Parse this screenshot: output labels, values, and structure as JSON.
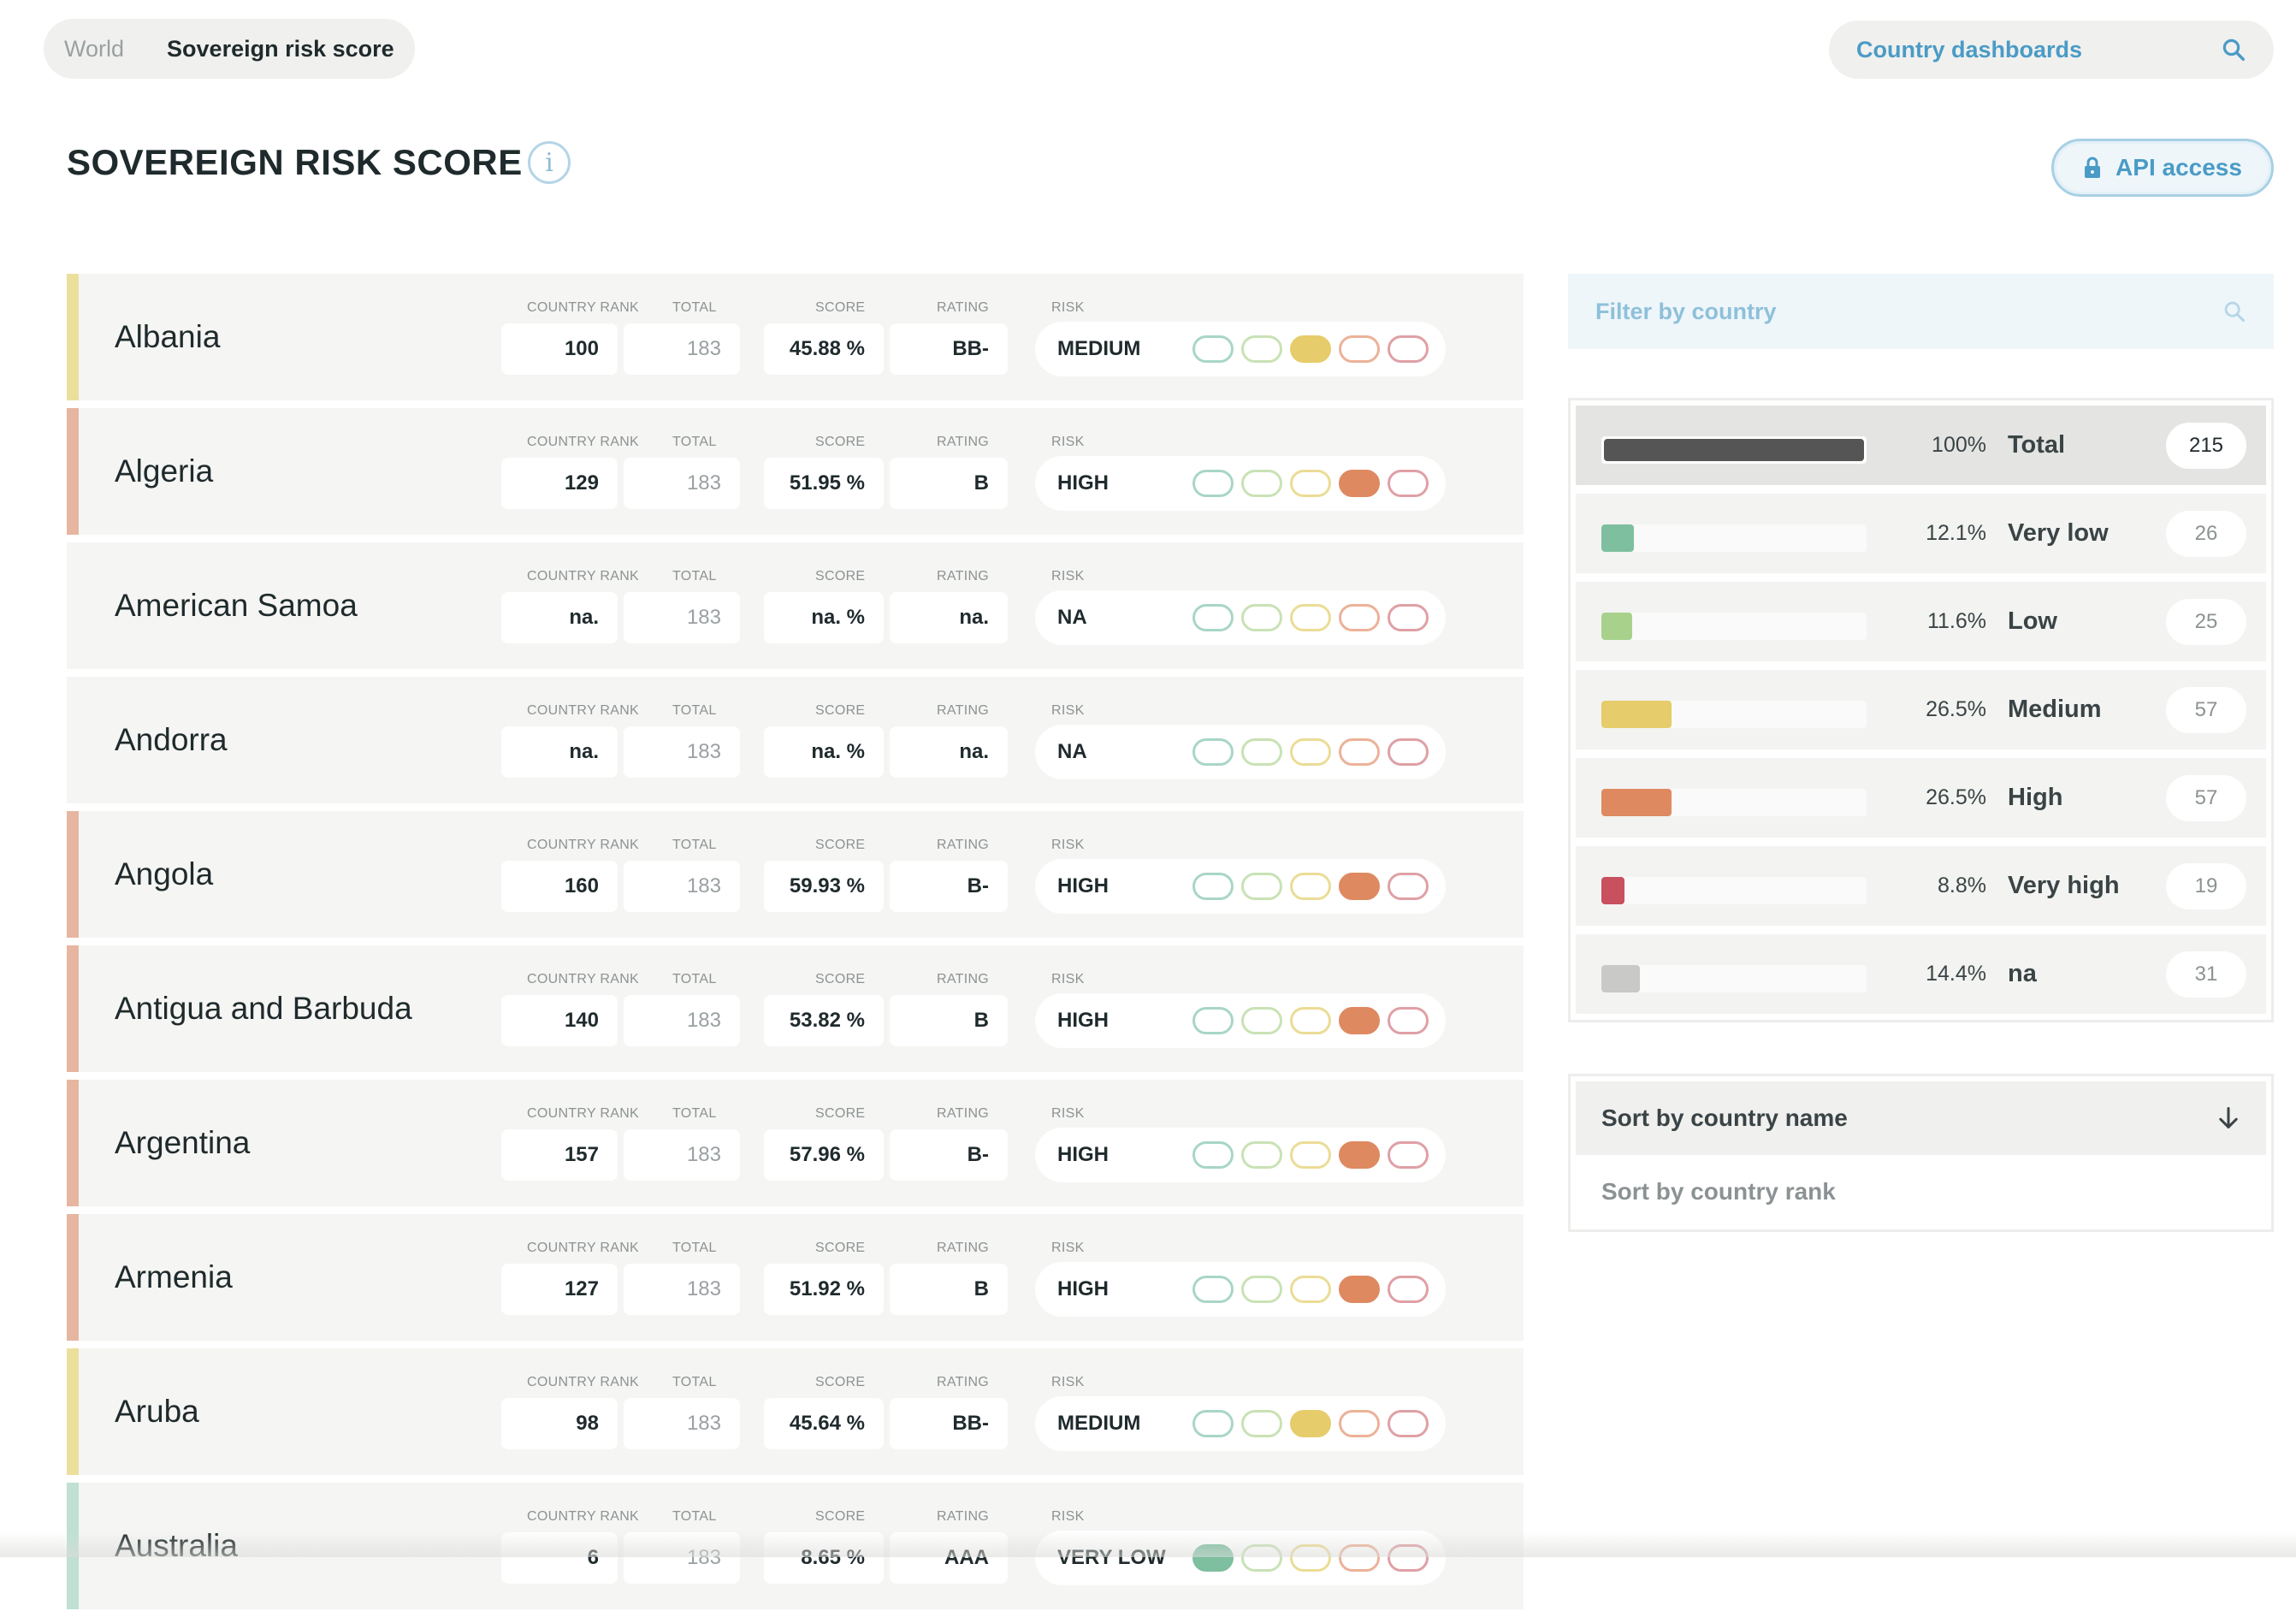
{
  "breadcrumb": {
    "world": "World",
    "current": "Sovereign risk score"
  },
  "dashboard_search": {
    "label": "Country dashboards"
  },
  "page": {
    "title": "SOVEREIGN RISK SCORE",
    "info_glyph": "i",
    "api_button": "API access"
  },
  "columns": {
    "rank": "COUNTRY RANK",
    "total": "TOTAL",
    "score": "SCORE",
    "rating": "RATING",
    "risk": "RISK"
  },
  "countries": [
    {
      "name": "Albania",
      "rank": "100",
      "total": "183",
      "score": "45.88 %",
      "rating": "BB-",
      "risk": "MEDIUM",
      "level": 3,
      "accent": "#ebdf9c"
    },
    {
      "name": "Algeria",
      "rank": "129",
      "total": "183",
      "score": "51.95 %",
      "rating": "B",
      "risk": "HIGH",
      "level": 4,
      "accent": "#e6b6a0"
    },
    {
      "name": "American Samoa",
      "rank": "na.",
      "total": "183",
      "score": "na. %",
      "rating": "na.",
      "risk": "NA",
      "level": 0,
      "accent": ""
    },
    {
      "name": "Andorra",
      "rank": "na.",
      "total": "183",
      "score": "na. %",
      "rating": "na.",
      "risk": "NA",
      "level": 0,
      "accent": ""
    },
    {
      "name": "Angola",
      "rank": "160",
      "total": "183",
      "score": "59.93 %",
      "rating": "B-",
      "risk": "HIGH",
      "level": 4,
      "accent": "#e6b6a0"
    },
    {
      "name": "Antigua and Barbuda",
      "rank": "140",
      "total": "183",
      "score": "53.82 %",
      "rating": "B",
      "risk": "HIGH",
      "level": 4,
      "accent": "#e6b6a0"
    },
    {
      "name": "Argentina",
      "rank": "157",
      "total": "183",
      "score": "57.96 %",
      "rating": "B-",
      "risk": "HIGH",
      "level": 4,
      "accent": "#e6b6a0"
    },
    {
      "name": "Armenia",
      "rank": "127",
      "total": "183",
      "score": "51.92 %",
      "rating": "B",
      "risk": "HIGH",
      "level": 4,
      "accent": "#e6b6a0"
    },
    {
      "name": "Aruba",
      "rank": "98",
      "total": "183",
      "score": "45.64 %",
      "rating": "BB-",
      "risk": "MEDIUM",
      "level": 3,
      "accent": "#ebdf9c"
    },
    {
      "name": "Australia",
      "rank": "6",
      "total": "183",
      "score": "8.65 %",
      "rating": "AAA",
      "risk": "VERY LOW",
      "level": 1,
      "accent": "#bfe0d3"
    }
  ],
  "filter": {
    "placeholder": "Filter by country"
  },
  "distribution": [
    {
      "pct": "100%",
      "label": "Total",
      "count": "215",
      "fraction": 1.0,
      "color": "#555555"
    },
    {
      "pct": "12.1%",
      "label": "Very low",
      "count": "26",
      "fraction": 0.121,
      "color": "#7dbf9f"
    },
    {
      "pct": "11.6%",
      "label": "Low",
      "count": "25",
      "fraction": 0.116,
      "color": "#a8d28c"
    },
    {
      "pct": "26.5%",
      "label": "Medium",
      "count": "57",
      "fraction": 0.265,
      "color": "#e6cc6a"
    },
    {
      "pct": "26.5%",
      "label": "High",
      "count": "57",
      "fraction": 0.265,
      "color": "#de8960"
    },
    {
      "pct": "8.8%",
      "label": "Very high",
      "count": "19",
      "fraction": 0.088,
      "color": "#c8505f"
    },
    {
      "pct": "14.4%",
      "label": "na",
      "count": "31",
      "fraction": 0.144,
      "color": "#c9c9c7"
    }
  ],
  "sort": {
    "active": "Sort by country name",
    "option": "Sort by country rank",
    "icon": "arrow-down-icon"
  }
}
